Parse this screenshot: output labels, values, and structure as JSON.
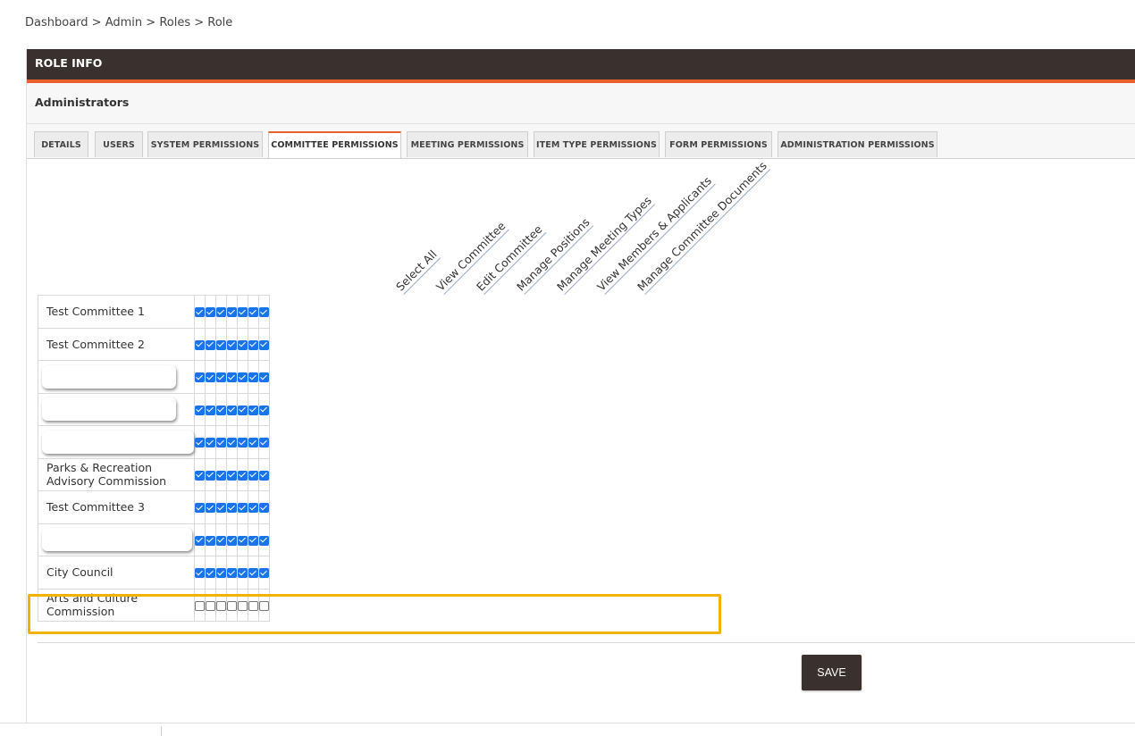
{
  "breadcrumb": [
    "Dashboard",
    "Admin",
    "Roles",
    "Role"
  ],
  "breadcrumb_separator": " > ",
  "panel": {
    "title": "ROLE INFO",
    "role_name": "Administrators"
  },
  "tabs": [
    {
      "label": "DETAILS",
      "active": false
    },
    {
      "label": "USERS",
      "active": false
    },
    {
      "label": "SYSTEM PERMISSIONS",
      "active": false
    },
    {
      "label": "COMMITTEE PERMISSIONS",
      "active": true
    },
    {
      "label": "MEETING PERMISSIONS",
      "active": false
    },
    {
      "label": "ITEM TYPE PERMISSIONS",
      "active": false
    },
    {
      "label": "FORM PERMISSIONS",
      "active": false
    },
    {
      "label": "ADMINISTRATION PERMISSIONS",
      "active": false
    }
  ],
  "columns": [
    "Select All",
    "View Committee",
    "Edit Committee",
    "Manage Positions",
    "Manage Meeting Types",
    "View Members & Applicants",
    "Manage Committee Documents"
  ],
  "rows": [
    {
      "name": "Test Committee 1",
      "redacted": false,
      "checked": [
        true,
        true,
        true,
        true,
        true,
        true,
        true
      ]
    },
    {
      "name": "Test Committee 2",
      "redacted": false,
      "checked": [
        true,
        true,
        true,
        true,
        true,
        true,
        true
      ]
    },
    {
      "name": "",
      "redacted": true,
      "checked": [
        true,
        true,
        true,
        true,
        true,
        true,
        true
      ]
    },
    {
      "name": "",
      "redacted": true,
      "checked": [
        true,
        true,
        true,
        true,
        true,
        true,
        true
      ]
    },
    {
      "name": "",
      "redacted": true,
      "checked": [
        true,
        true,
        true,
        true,
        true,
        true,
        true
      ]
    },
    {
      "name": "Parks & Recreation Advisory Commission",
      "redacted": false,
      "checked": [
        true,
        true,
        true,
        true,
        true,
        true,
        true
      ]
    },
    {
      "name": "Test Committee 3",
      "redacted": false,
      "checked": [
        true,
        true,
        true,
        true,
        true,
        true,
        true
      ]
    },
    {
      "name": "",
      "redacted": true,
      "checked": [
        true,
        true,
        true,
        true,
        true,
        true,
        true
      ]
    },
    {
      "name": "City Council",
      "redacted": false,
      "checked": [
        true,
        true,
        true,
        true,
        true,
        true,
        true
      ]
    },
    {
      "name": "Arts and Culture Commission",
      "redacted": false,
      "highlighted": true,
      "checked": [
        false,
        false,
        false,
        false,
        false,
        false,
        false
      ]
    }
  ],
  "save_label": "SAVE",
  "colors": {
    "header_bg": "#3a302d",
    "accent": "#e8612c",
    "checkbox": "#1a73e8",
    "highlight": "#f0b400"
  }
}
